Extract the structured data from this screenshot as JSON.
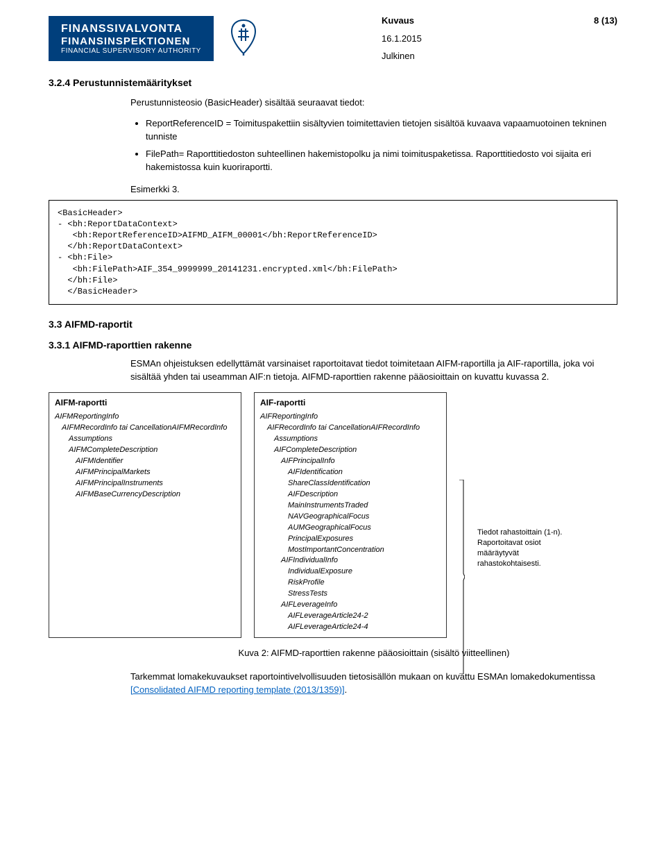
{
  "header": {
    "logo_l1": "FINANSSIVALVONTA",
    "logo_l2": "FINANSINSPEKTIONEN",
    "logo_l3": "FINANCIAL SUPERVISORY AUTHORITY",
    "kuvaus": "Kuvaus",
    "page_no": "8 (13)",
    "date": "16.1.2015",
    "julkinen": "Julkinen"
  },
  "s324": {
    "heading": "3.2.4 Perustunnistemääritykset",
    "intro": "Perustunnisteosio (BasicHeader) sisältää seuraavat tiedot:",
    "bullets": [
      "ReportReferenceID = Toimituspakettiin sisältyvien toimitettavien tietojen sisältöä kuvaava vapaamuotoinen tekninen tunniste",
      "FilePath= Raporttitiedoston suhteellinen hakemistopolku ja nimi toimituspaketissa. Raporttitiedosto voi sijaita eri hakemistossa kuin kuoriraportti."
    ],
    "esimerkki": "Esimerkki 3.",
    "code": "<BasicHeader>\n- <bh:ReportDataContext>\n   <bh:ReportReferenceID>AIFMD_AIFM_00001</bh:ReportReferenceID>\n  </bh:ReportDataContext>\n- <bh:File>\n   <bh:FilePath>AIF_354_9999999_20141231.encrypted.xml</bh:FilePath>\n  </bh:File>\n  </BasicHeader>"
  },
  "s33": {
    "heading": "3.3 AIFMD-raportit"
  },
  "s331": {
    "heading": "3.3.1 AIFMD-raporttien rakenne",
    "para": "ESMAn ohjeistuksen edellyttämät varsinaiset raportoitavat tiedot toimitetaan AIFM-raportilla ja AIF-raportilla, joka voi sisältää yhden tai useamman AIF:n tietoja. AIFMD-raporttien rakenne pääosioittain on kuvattu kuvassa 2."
  },
  "diagram": {
    "left_title": "AIFM-raportti",
    "right_title": "AIF-raportti",
    "left": [
      {
        "t": "AIFMReportingInfo",
        "i": 1
      },
      {
        "t": "AIFMRecordInfo tai CancellationAIFMRecordInfo",
        "i": 2
      },
      {
        "t": "Assumptions",
        "i": 3
      },
      {
        "t": "AIFMCompleteDescription",
        "i": 3
      },
      {
        "t": "AIFMIdentifier",
        "i": 4
      },
      {
        "t": "AIFMPrincipalMarkets",
        "i": 4
      },
      {
        "t": "AIFMPrincipalInstruments",
        "i": 4
      },
      {
        "t": "AIFMBaseCurrencyDescription",
        "i": 4
      }
    ],
    "right": [
      {
        "t": "AIFReportingInfo",
        "i": 1
      },
      {
        "t": "AIFRecordInfo tai CancellationAIFRecordInfo",
        "i": 2
      },
      {
        "t": "Assumptions",
        "i": 3
      },
      {
        "t": "AIFCompleteDescription",
        "i": 3
      },
      {
        "t": "AIFPrincipalInfo",
        "i": 4
      },
      {
        "t": "AIFIdentification",
        "i": 5
      },
      {
        "t": "ShareClassIdentification",
        "i": 5
      },
      {
        "t": "AIFDescription",
        "i": 5
      },
      {
        "t": "MainInstrumentsTraded",
        "i": 5
      },
      {
        "t": "NAVGeographicalFocus",
        "i": 5
      },
      {
        "t": "AUMGeographicalFocus",
        "i": 5
      },
      {
        "t": "PrincipalExposures",
        "i": 5
      },
      {
        "t": "MostImportantConcentration",
        "i": 5
      },
      {
        "t": "AIFIndividualInfo",
        "i": 4
      },
      {
        "t": "IndividualExposure",
        "i": 5
      },
      {
        "t": "RiskProfile",
        "i": 5
      },
      {
        "t": "StressTests",
        "i": 5
      },
      {
        "t": "AIFLeverageInfo",
        "i": 4
      },
      {
        "t": "AIFLeverageArticle24-2",
        "i": 5
      },
      {
        "t": "AIFLeverageArticle24-4",
        "i": 5
      }
    ],
    "side_note": "Tiedot rahastoittain (1-n). Raportoitavat osiot määräytyvät rahastokohtaisesti."
  },
  "caption": "Kuva 2: AIFMD-raporttien rakenne pääosioittain (sisältö viitteellinen)",
  "footer": {
    "text_before": "Tarkemmat lomakekuvaukset raportointivelvollisuuden tietosisällön mukaan on kuvattu ESMAn lomakedokumentissa ",
    "link_text": "[Consolidated AIFMD reporting template (2013/1359)]",
    "text_after": "."
  }
}
